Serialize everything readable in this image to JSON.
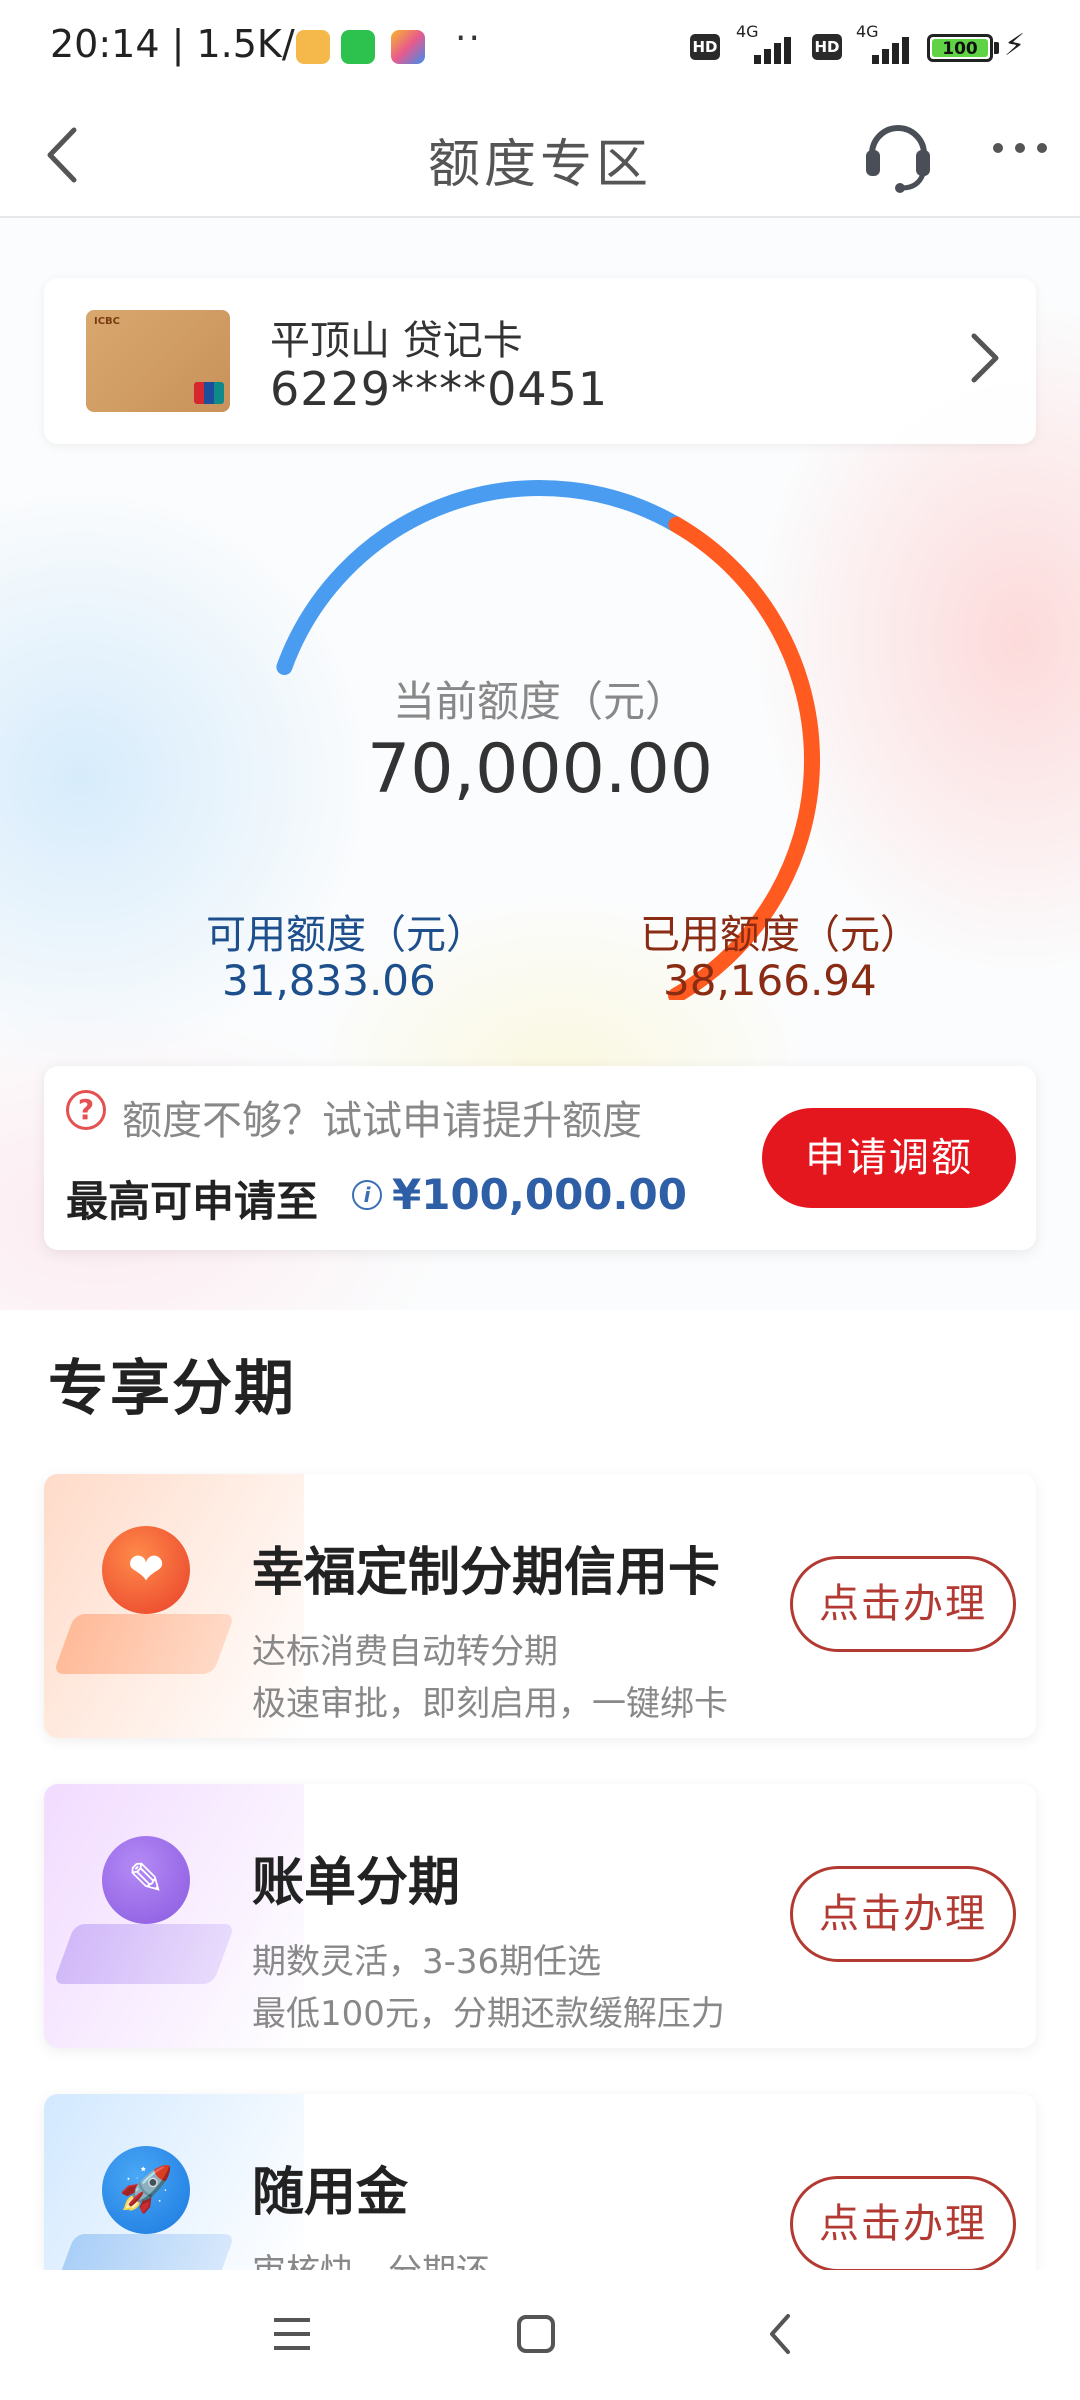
{
  "status_bar": {
    "time": "20:14",
    "speed": "1.5K/s",
    "network1": "4G",
    "network2": "4G",
    "hd_label": "HD",
    "battery": "100",
    "more_dots": "··"
  },
  "nav": {
    "title": "额度专区",
    "back_icon": "chevron-left-icon",
    "service_icon": "headset-icon",
    "more_icon": "more-icon"
  },
  "card": {
    "name": "平顶山 贷记卡",
    "number": "6229****0451"
  },
  "gauge": {
    "label": "当前额度（元）",
    "total": "70,000.00",
    "available_label": "可用额度（元）",
    "available": "31,833.06",
    "used_label": "已用额度（元）",
    "used": "38,166.94",
    "available_fraction": 0.455,
    "colors": {
      "available": "#4a9cf0",
      "used": "#ff5a1f"
    }
  },
  "raise": {
    "tip": "额度不够？试试申请提升额度",
    "max_label": "最高可申请至",
    "max_amount": "¥100,000.00",
    "button": "申请调额"
  },
  "section": {
    "title": "专享分期"
  },
  "items": [
    {
      "title": "幸福定制分期信用卡",
      "desc1": "达标消费自动转分期",
      "desc2": "极速审批，即刻启用，一键绑卡",
      "button": "点击办理",
      "icon": "heart-icon",
      "color": "#f0602e"
    },
    {
      "title": "账单分期",
      "desc1": "期数灵活，3-36期任选",
      "desc2": "最低100元，分期还款缓解压力",
      "button": "点击办理",
      "icon": "pencil-icon",
      "color": "#9a6be8"
    },
    {
      "title": "随用金",
      "desc1": "审核快，分期还",
      "button": "点击办理",
      "icon": "rocket-icon",
      "color": "#2e8ff0"
    }
  ],
  "bottom_nav": {
    "menu_icon": "menu-icon",
    "home_icon": "home-icon",
    "back_icon": "back-icon"
  }
}
